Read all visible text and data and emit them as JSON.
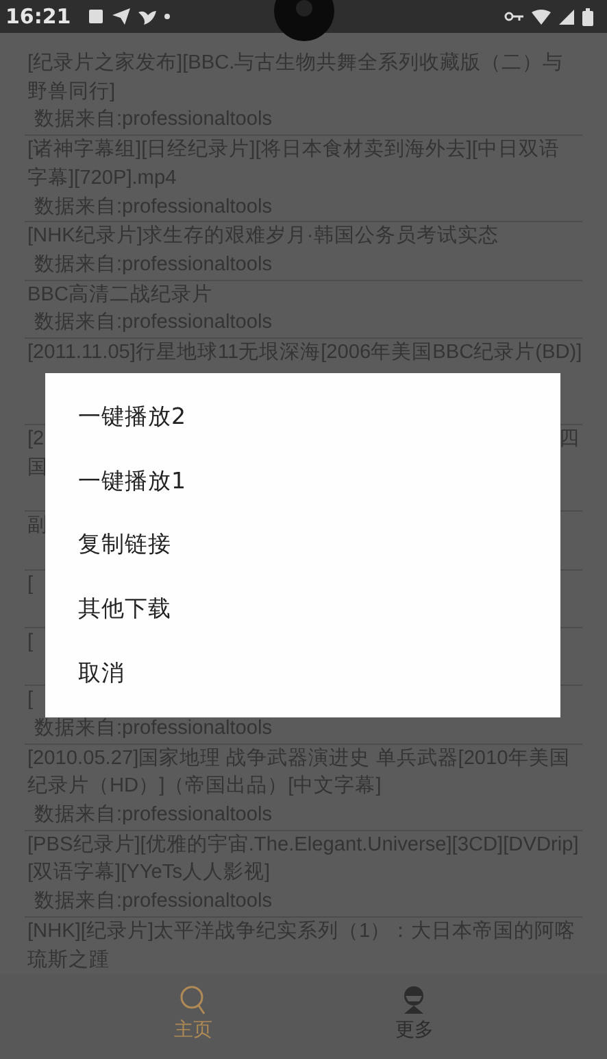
{
  "status_bar": {
    "time": "16:21"
  },
  "list": [
    {
      "kind": "full",
      "title": "[纪录片之家发布][BBC.与古生物共舞全系列收藏版（二）与野兽同行]",
      "source": "数据来自:professionaltools"
    },
    {
      "kind": "full",
      "title": "[诸神字幕组][日经纪录片][将日本食材卖到海外去][中日双语字幕][720P].mp4",
      "source": "数据来自:professionaltools"
    },
    {
      "kind": "full",
      "title": "[NHK纪录片]求生存的艰难岁月·韩国公务员考试实态",
      "source": "数据来自:professionaltools"
    },
    {
      "kind": "full",
      "title": "BBC高清二战纪录片",
      "source": "数据来自:professionaltools"
    },
    {
      "kind": "covered",
      "lines": [
        {
          "left": "[2011.11.05]行星地球11无垠深海[2006年美国BBC纪录片(BD)]"
        }
      ]
    },
    {
      "kind": "covered",
      "lines": [
        {
          "left": "[2",
          "right": "四"
        },
        {
          "left": "国"
        }
      ]
    },
    {
      "kind": "covered",
      "lines": [
        {
          "left": "副"
        }
      ]
    },
    {
      "kind": "covered",
      "lines": [
        {
          "left": "["
        }
      ]
    },
    {
      "kind": "covered",
      "lines": [
        {
          "left": "["
        }
      ]
    },
    {
      "kind": "covered",
      "lines": [
        {
          "left": "["
        }
      ],
      "source": "数据来自:professionaltools"
    },
    {
      "kind": "full",
      "title": "[2010.05.27]国家地理 战争武器演进史 单兵武器[2010年美国纪录片（HD）]（帝国出品）[中文字幕]",
      "source": "数据来自:professionaltools"
    },
    {
      "kind": "full",
      "title": "[PBS纪录片][优雅的宇宙.The.Elegant.Universe][3CD][DVDrip][双语字幕][YYeTs人人影视]",
      "source": "数据来自:professionaltools"
    },
    {
      "kind": "full",
      "title": "[NHK][纪录片]太平洋战争纪实系列（1）：大日本帝国的阿喀琉斯之踵"
    }
  ],
  "dialog": {
    "options": [
      "一键播放2",
      "一键播放1",
      "复制链接",
      "其他下载",
      "取消"
    ]
  },
  "nav": [
    {
      "kind": "search",
      "label": "主页",
      "selected": true
    },
    {
      "kind": "user",
      "label": "更多",
      "selected": false
    }
  ]
}
